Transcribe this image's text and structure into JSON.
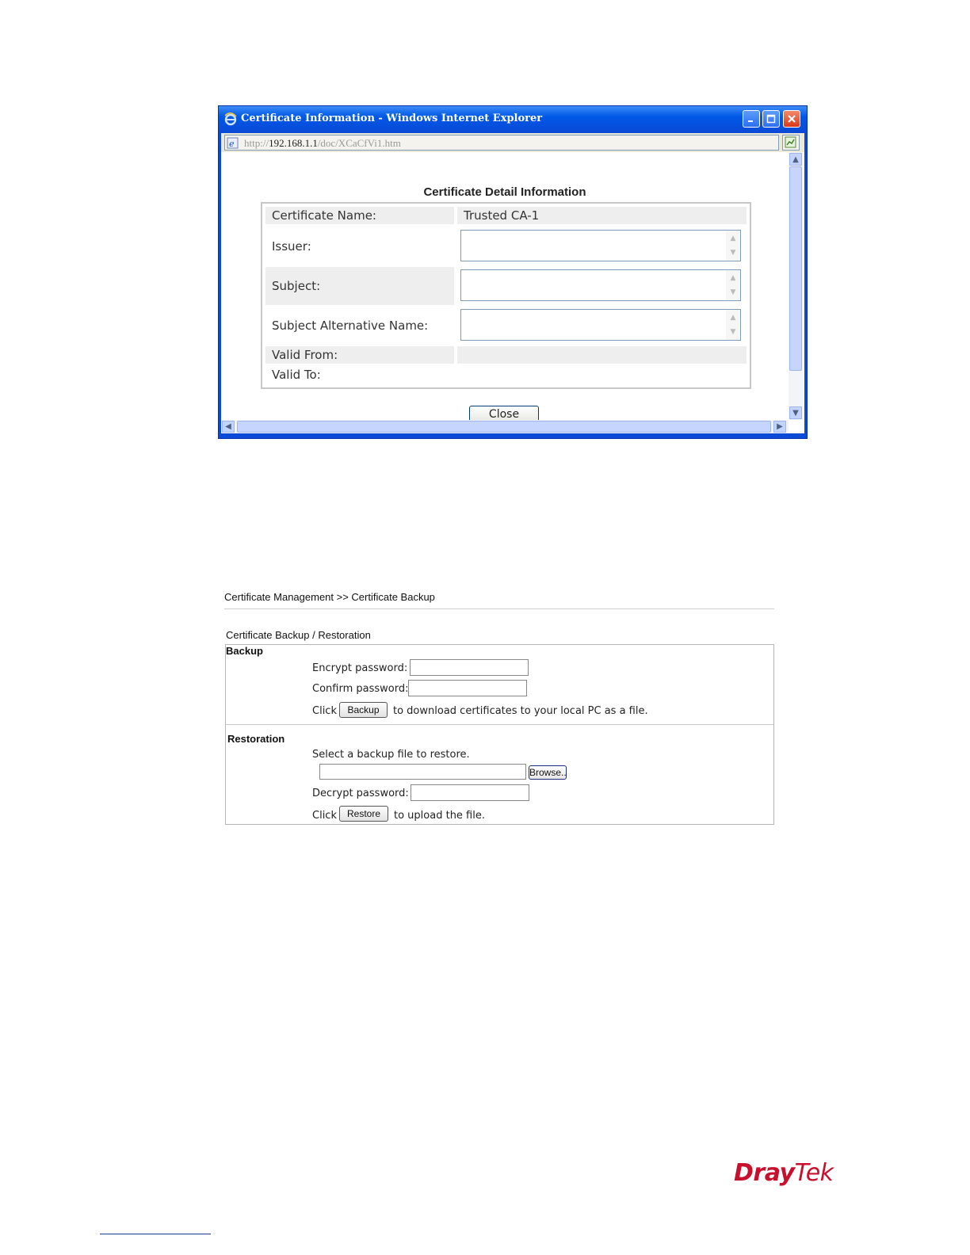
{
  "ie_window": {
    "title": "Certificate Information - Windows Internet Explorer",
    "address_prefix": "http://",
    "address_host": "192.168.1.1",
    "address_path": "/doc/XCaCfVi1.htm",
    "heading": "Certificate Detail Information",
    "rows": {
      "cert_name_label": "Certificate Name:",
      "cert_name_value": "Trusted CA-1",
      "issuer_label": "Issuer:",
      "subject_label": "Subject:",
      "san_label": "Subject Alternative Name:",
      "valid_from_label": "Valid From:",
      "valid_to_label": "Valid To:"
    },
    "close_label": "Close"
  },
  "backup_page": {
    "breadcrumb": "Certificate Management >> Certificate Backup",
    "title": "Certificate Backup / Restoration",
    "backup": {
      "section_label": "Backup",
      "encrypt_label": "Encrypt password:",
      "confirm_label": "Confirm password:",
      "click_label": "Click",
      "button_label": "Backup",
      "suffix": "to download certificates to your local PC as a file."
    },
    "restoration": {
      "section_label": "Restoration",
      "select_label": "Select a backup file to restore.",
      "browse_label": "Browse..",
      "decrypt_label": "Decrypt password:",
      "click_label": "Click",
      "button_label": "Restore",
      "suffix": "to upload the file."
    }
  },
  "brand": {
    "logo_dray": "Dray",
    "logo_tek": "Tek",
    "logo_color": "#c8102e"
  },
  "colors": {
    "ie_titlebar": "#0a4ad6",
    "row_shade": "#eeeeee"
  }
}
